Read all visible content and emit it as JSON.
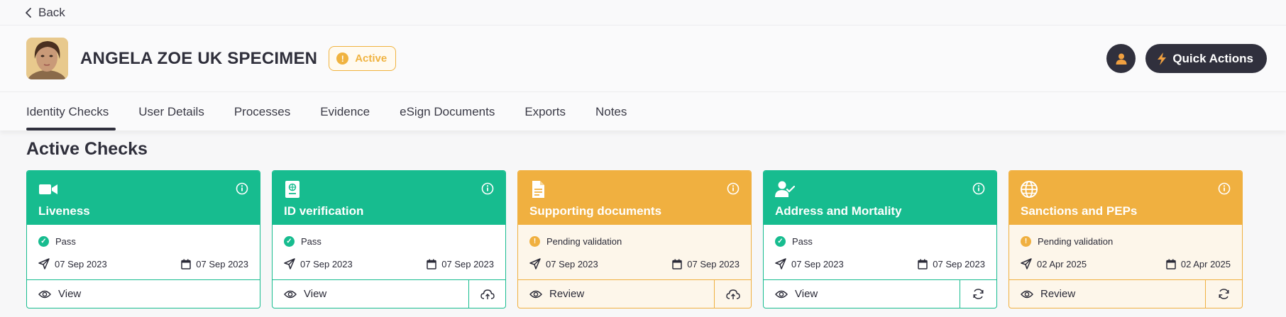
{
  "nav": {
    "back_label": "Back"
  },
  "profile": {
    "name": "ANGELA ZOE UK SPECIMEN",
    "status": "Active",
    "status_icon": "exclamation-icon",
    "quick_actions_label": "Quick Actions"
  },
  "tabs": [
    {
      "label": "Identity Checks",
      "active": true
    },
    {
      "label": "User Details"
    },
    {
      "label": "Processes"
    },
    {
      "label": "Evidence"
    },
    {
      "label": "eSign Documents"
    },
    {
      "label": "Exports"
    },
    {
      "label": "Notes"
    }
  ],
  "section": {
    "title": "Active Checks"
  },
  "colors": {
    "pass": "#17bc8f",
    "pending": "#f0b040",
    "dark": "#30303d"
  },
  "cards": [
    {
      "title": "Liveness",
      "icon": "video-camera-icon",
      "status": "Pass",
      "sent": "07 Sep 2023",
      "date": "07 Sep 2023",
      "action": "View",
      "side_action_icon": ""
    },
    {
      "title": "ID verification",
      "icon": "passport-icon",
      "status": "Pass",
      "sent": "07 Sep 2023",
      "date": "07 Sep 2023",
      "action": "View",
      "side_action_icon": "upload-cloud-icon"
    },
    {
      "title": "Supporting documents",
      "icon": "document-icon",
      "status": "Pending validation",
      "sent": "07 Sep 2023",
      "date": "07 Sep 2023",
      "action": "Review",
      "side_action_icon": "upload-cloud-icon"
    },
    {
      "title": "Address and Mortality",
      "icon": "user-check-icon",
      "status": "Pass",
      "sent": "07 Sep 2023",
      "date": "07 Sep 2023",
      "action": "View",
      "side_action_icon": "refresh-icon"
    },
    {
      "title": "Sanctions and PEPs",
      "icon": "globe-icon",
      "status": "Pending validation",
      "sent": "02 Apr 2025",
      "date": "02 Apr 2025",
      "action": "Review",
      "side_action_icon": "refresh-icon"
    }
  ]
}
